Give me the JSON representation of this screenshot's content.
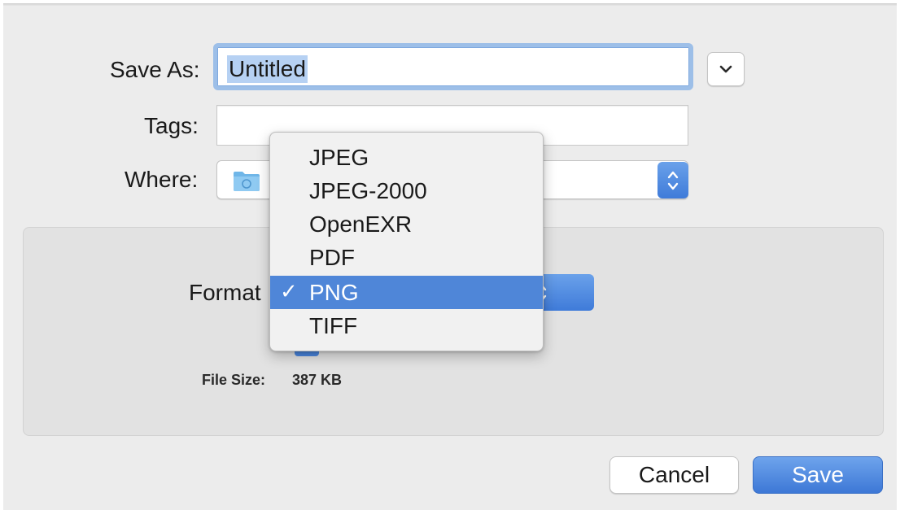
{
  "dialog": {
    "save_as_label": "Save As:",
    "save_as_value": "Untitled",
    "tags_label": "Tags:",
    "tags_value": "",
    "where_label": "Where:"
  },
  "options": {
    "format_label": "Format",
    "file_size_label": "File Size:",
    "file_size_value": "387 KB"
  },
  "format_menu": {
    "items": [
      {
        "label": "JPEG",
        "selected": false
      },
      {
        "label": "JPEG-2000",
        "selected": false
      },
      {
        "label": "OpenEXR",
        "selected": false
      },
      {
        "label": "PDF",
        "selected": false
      },
      {
        "label": "PNG",
        "selected": true
      },
      {
        "label": "TIFF",
        "selected": false
      }
    ],
    "check_mark": "✓"
  },
  "buttons": {
    "cancel_label": "Cancel",
    "save_label": "Save"
  },
  "icons": {
    "expand": "chevron-down-icon",
    "where_folder": "folder-icon",
    "stepper": "up-down-arrows-icon"
  },
  "colors": {
    "accent": "#4f86d8",
    "selection_highlight": "#b6d1f3",
    "focus_ring": "#9dbfe8"
  }
}
